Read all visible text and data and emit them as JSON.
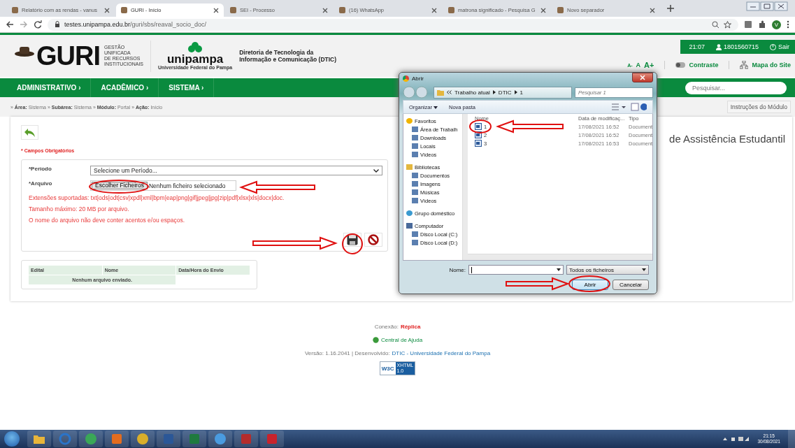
{
  "browser": {
    "tabs": [
      {
        "title": "Relatório com as rendas - vanus",
        "selected": false
      },
      {
        "title": "GURI - Início",
        "selected": true
      },
      {
        "title": "SEI - Processo",
        "selected": false
      },
      {
        "title": "(16) WhatsApp",
        "selected": false
      },
      {
        "title": "matrona significado - Pesquisa G",
        "selected": false
      },
      {
        "title": "Novo separador",
        "selected": false
      }
    ],
    "url_host": "testes.unipampa.edu.br",
    "url_path": "/guri/sbs/reaval_socio_doc/",
    "profile_initial": "V"
  },
  "header": {
    "guri_logo": "GURI",
    "guri_subtitle": [
      "GESTÃO",
      "UNIFICADA",
      "DE RECURSOS",
      "INSTITUCIONAIS"
    ],
    "unipampa_logo": "unipampa",
    "unipampa_caption": "Universidade Federal do Pampa",
    "dtic_name": [
      "Diretoria de Tecnologia da",
      "Informação e Comunicação (DTIC)"
    ],
    "session": {
      "time": "21:07",
      "user": "1801560715",
      "logout": "Sair"
    },
    "font_sizes": [
      "A-",
      "A",
      "A+"
    ],
    "contrast": "Contraste",
    "sitemap": "Mapa do Site"
  },
  "nav": {
    "items": [
      "ADMINISTRATIVO ›",
      "ACADÊMICO ›",
      "SISTEMA ›"
    ],
    "search_placeholder": "Pesquisar..."
  },
  "breadcrumb": "» **Área:** Sistema » **Subárea:** Sistema » **Módulo:** Portal » **Ação:** Início",
  "module_help": "Instruções do Módulo",
  "page_title": "de Assistência Estudantil",
  "form": {
    "required_note": "* Campos Obrigatórios",
    "period": {
      "label": "*Período",
      "value": "Selecione um Período..."
    },
    "file": {
      "label": "*Arquivo",
      "button": "Escolher Ficheiros",
      "status": "Nenhum ficheiro selecionado"
    },
    "notes": [
      "Extensões suportadas: txt|ods|odt|csv|xpdl|xml|bpm|eap|png|gif|jpeg|jpg|zip|pdf|xlsx|xls|docx|doc.",
      "Tamanho máximo: 20 MB por arquivo.",
      "O nome do arquivo não deve conter acentos e/ou espaços."
    ]
  },
  "table": {
    "columns": [
      "Edital",
      "Nome",
      "Data/Hora do Envio"
    ],
    "empty_message": "Nenhum arquivo enviado."
  },
  "footer": {
    "connection": "Conexão: **Réplica**",
    "help": "Central de Ajuda",
    "version": "Versão: 1.16.2041 | Desenvolvido:",
    "developer_link": "DTIC - Universidade Federal do Pampa",
    "badge": [
      "W3C",
      "XHTML",
      "1.0"
    ]
  },
  "dialog": {
    "title": "Abrir",
    "path": [
      "Trabalho atual",
      "DTIC",
      "1"
    ],
    "search_placeholder": "Pesquisar 1",
    "toolbar": [
      "Organizar",
      "Nova pasta"
    ],
    "nav_pane": [
      {
        "label": "Favoritos",
        "children": [
          {
            "label": "Área de Trabalh"
          },
          {
            "label": "Downloads"
          },
          {
            "label": "Locais"
          },
          {
            "label": "Vídeos"
          }
        ]
      },
      {
        "label": "Bibliotecas",
        "children": [
          {
            "label": "Documentos"
          },
          {
            "label": "Imagens"
          },
          {
            "label": "Músicas"
          },
          {
            "label": "Vídeos"
          }
        ]
      },
      {
        "label": "Grupo doméstico"
      },
      {
        "label": "Computador",
        "children": [
          {
            "label": "Disco Local (C:)"
          },
          {
            "label": "Disco Local (D:)"
          }
        ]
      }
    ],
    "columns": [
      "Nome",
      "Data de modificaç...",
      "Tipo"
    ],
    "files": [
      {
        "name": "1",
        "modified": "17/08/2021 16:52",
        "type": "Document"
      },
      {
        "name": "2",
        "modified": "17/08/2021 16:52",
        "type": "Document"
      },
      {
        "name": "3",
        "modified": "17/08/2021 16:53",
        "type": "Document"
      }
    ],
    "filename_label": "Nome:",
    "filetype": "Todos os ficheiros",
    "buttons": [
      "Abrir",
      "Cancelar"
    ]
  },
  "taskbar": {
    "time": "21:15",
    "date": "30/08/2021"
  }
}
